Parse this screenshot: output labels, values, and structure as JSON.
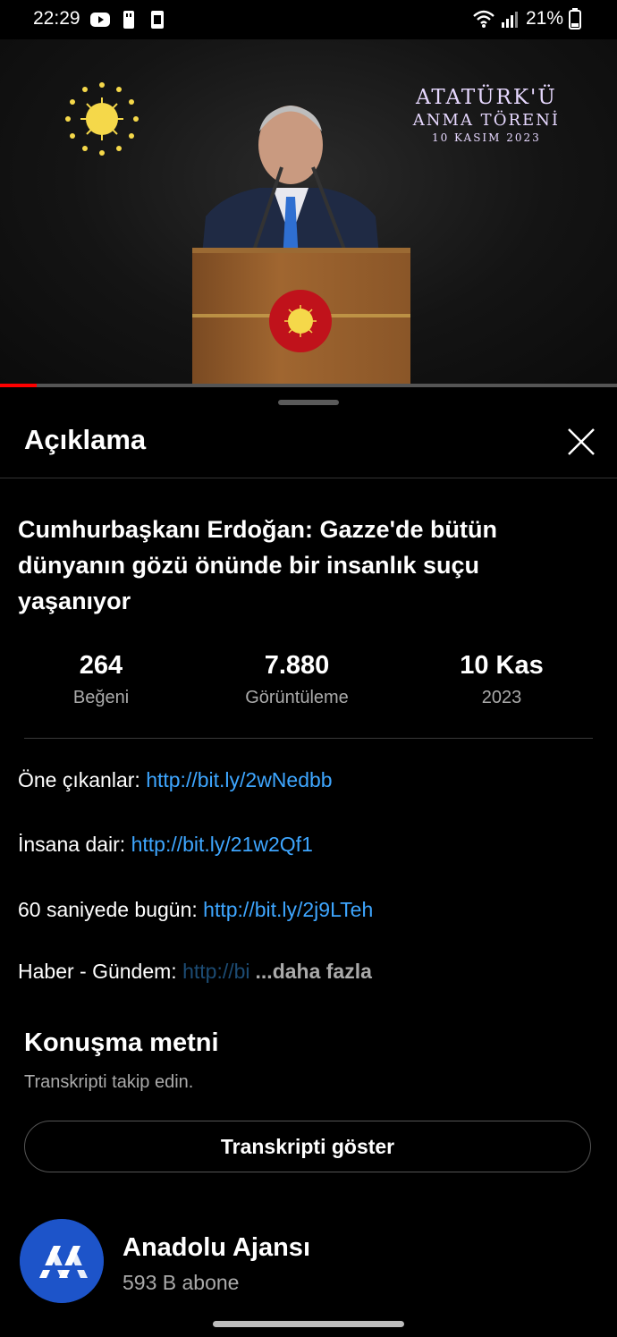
{
  "status_bar": {
    "time": "22:29",
    "battery": "21%",
    "icons": [
      "youtube-icon",
      "usb-icon",
      "sim-icon",
      "wifi-icon",
      "signal-icon",
      "battery-icon"
    ]
  },
  "video": {
    "overlay_title": "ATATÜRK'Ü",
    "overlay_subtitle": "ANMA TÖRENİ",
    "overlay_date": "10 KASIM 2023",
    "progress": 0.06,
    "colors": {
      "progress": "#ff0000"
    }
  },
  "sheet": {
    "title": "Açıklama",
    "close_icon": "close-icon"
  },
  "video_title": "Cumhurbaşkanı Erdoğan: Gazze'de bütün dünyanın gözü önünde bir insanlık suçu yaşanıyor",
  "stats": [
    {
      "value": "264",
      "label": "Beğeni"
    },
    {
      "value": "7.880",
      "label": "Görüntüleme"
    },
    {
      "value": "10 Kas",
      "label": "2023"
    }
  ],
  "description": [
    {
      "label": "Öne çıkanlar: ",
      "link": "http://bit.ly/2wNedbb"
    },
    {
      "label": "İnsana dair: ",
      "link": "http://bit.ly/21w2Qf1"
    },
    {
      "label": "60 saniyede bugün: ",
      "link": "http://bit.ly/2j9LTeh"
    },
    {
      "label": "Haber - Gündem: ",
      "link": "http://bi",
      "more": "...daha fazla"
    }
  ],
  "transcript": {
    "title": "Konuşma metni",
    "subtitle": "Transkripti takip edin.",
    "button": "Transkripti göster"
  },
  "channel": {
    "name": "Anadolu Ajansı",
    "subscribers": "593 B abone",
    "avatar_color": "#1d54c9"
  }
}
